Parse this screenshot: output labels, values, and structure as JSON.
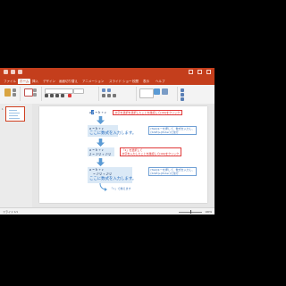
{
  "app": {
    "ribbon_tabs": [
      "ファイル",
      "ホーム",
      "挿入",
      "デザイン",
      "画面切り替え",
      "アニメーション",
      "スライド ショー",
      "校閲",
      "表示",
      "ヘルプ"
    ],
    "active_tab_index": 1
  },
  "thumbnail": {
    "slide_number": "1"
  },
  "slide": {
    "eq1_before": "a",
    "eq1_selected": "2",
    "eq1_after": " = b + c",
    "eq2": "a = b + c",
    "eq2_sub": "2 = 1^2 + 1^2",
    "eq3": "a = b + c",
    "eq3_line2": "= 1^2 + 2^2",
    "placeholder_text": "ここに数式を入力します。"
  },
  "callouts": {
    "c1": "文字を選択を選択したことを確認して[OK]をクリック",
    "c2_line1": "「2」を選択して",
    "c2_line2": "文字を入力したことを確認して[OK]をクリック",
    "c3_line1": "[Tab]キーを押して、数式を入力し、",
    "c3_line2": "[Shift]+[Enter]で改行",
    "c4_line1": "[Tab]キーを押して、数式を入力し、",
    "c4_line2": "[Shift]+[Enter]で改行",
    "c5": "「=」で揃えます"
  },
  "status": {
    "left": "スライド 1/1",
    "right": "100%"
  },
  "colors": {
    "ribbon": "#c43e1c",
    "equation_box": "#dbe9f6",
    "accent_blue": "#2a6fc0",
    "callout_red": "#e03a3a"
  }
}
